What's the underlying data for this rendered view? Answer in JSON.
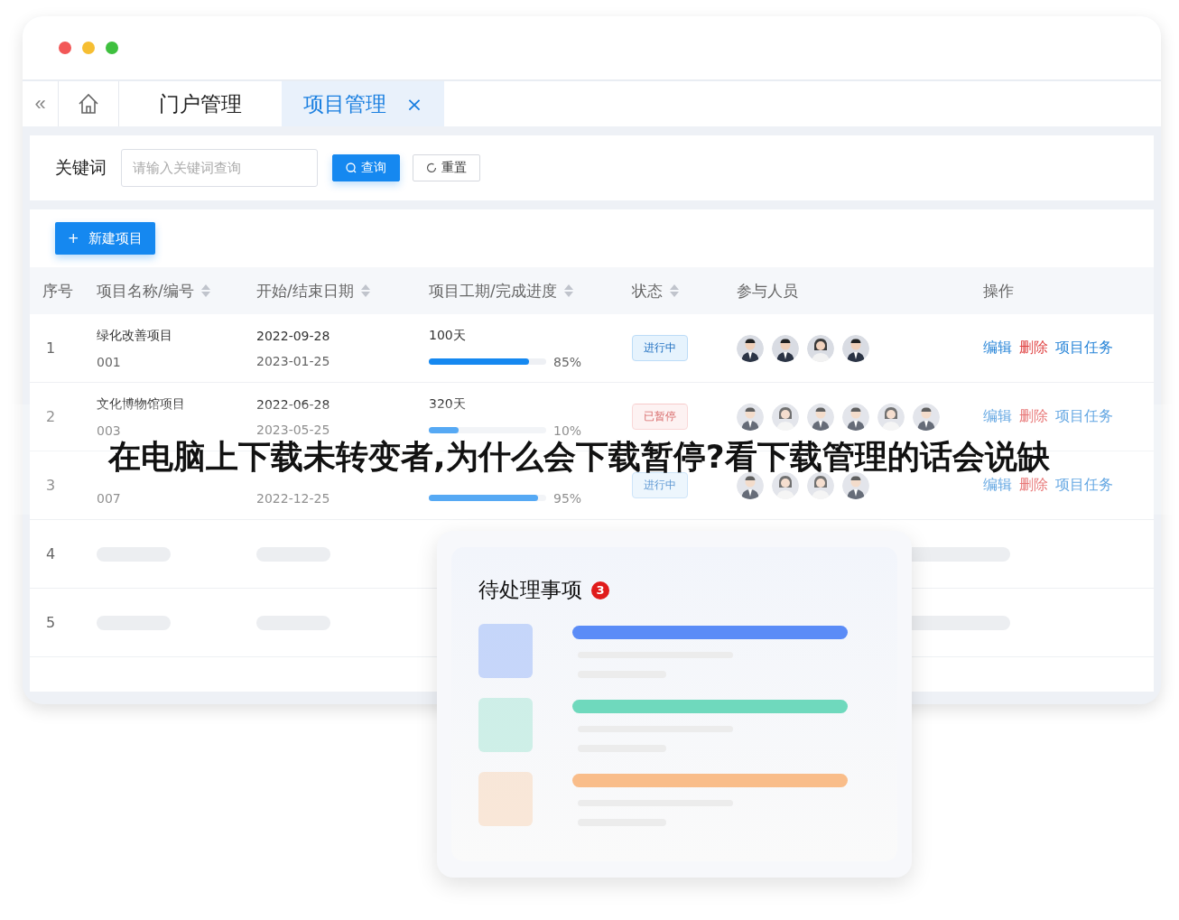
{
  "window": {
    "collapse": "«",
    "tabs": [
      {
        "label": "门户管理",
        "selected": false
      },
      {
        "label": "项目管理",
        "selected": true,
        "close": "×"
      }
    ]
  },
  "search": {
    "label": "关键词",
    "placeholder": "请输入关键词查询",
    "buttons": [
      {
        "label": "查询",
        "kind": "primary"
      },
      {
        "label": "重置",
        "kind": "default"
      }
    ]
  },
  "new_button": {
    "icon": "+",
    "label": "新建项目"
  },
  "table": {
    "columns": [
      {
        "label": "序号",
        "sortable": false
      },
      {
        "label": "项目名称/编号",
        "sortable": true
      },
      {
        "label": "开始/结束日期",
        "sortable": true
      },
      {
        "label": "项目工期/完成进度",
        "sortable": true
      },
      {
        "label": "状态",
        "sortable": true
      },
      {
        "label": "参与人员",
        "sortable": false
      },
      {
        "label": "操作",
        "sortable": false
      }
    ],
    "rows": [
      {
        "index": "1",
        "name": "绿化改善项目",
        "code": "001",
        "start": "2022-09-28",
        "end": "2023-01-25",
        "duration": "100天",
        "level": 0.85,
        "percent": "85%",
        "status": {
          "label": "进行中",
          "kind": "active"
        },
        "members": [
          {
            "kind": "man"
          },
          {
            "kind": "man"
          },
          {
            "kind": "woman"
          },
          {
            "kind": "man"
          }
        ],
        "actions": [
          {
            "label": "编辑",
            "kind": "link"
          },
          {
            "label": "删除",
            "kind": "danger"
          },
          {
            "label": "项目任务",
            "kind": "link"
          }
        ]
      },
      {
        "index": "2",
        "name": "文化博物馆项目",
        "code": "003",
        "start": "2022-06-28",
        "end": "2023-05-25",
        "duration": "320天",
        "level": 0.25,
        "percent": "10%",
        "status": {
          "label": "已暂停",
          "kind": "paused"
        },
        "members": [
          {
            "kind": "man"
          },
          {
            "kind": "woman"
          },
          {
            "kind": "man"
          },
          {
            "kind": "man"
          },
          {
            "kind": "woman"
          },
          {
            "kind": "man"
          }
        ],
        "actions": [
          {
            "label": "编辑",
            "kind": "link"
          },
          {
            "label": "删除",
            "kind": "danger"
          },
          {
            "label": "项目任务",
            "kind": "link"
          }
        ]
      },
      {
        "index": "3",
        "code": "007",
        "end": "2022-12-25",
        "level": 0.93,
        "percent": "95%",
        "status": {
          "label": "进行中",
          "kind": "active"
        },
        "members": [
          {
            "kind": "man"
          },
          {
            "kind": "woman"
          },
          {
            "kind": "woman"
          },
          {
            "kind": "man"
          }
        ],
        "actions": [
          {
            "label": "编辑",
            "kind": "link"
          },
          {
            "label": "删除",
            "kind": "danger"
          },
          {
            "label": "项目任务",
            "kind": "link"
          }
        ]
      }
    ],
    "placeholder_rows": [
      {
        "index": "4"
      },
      {
        "index": "5"
      }
    ]
  },
  "pending": {
    "title": "待处理事项",
    "badge": "3",
    "items": [
      {
        "color": "#5b8cf7"
      },
      {
        "color": "#6fd9bd"
      },
      {
        "color": "#f9bd8a"
      }
    ]
  },
  "overlay_title": "在电脑上下载未转变者,为什么会下载暂停?看下载管理的话会说缺"
}
